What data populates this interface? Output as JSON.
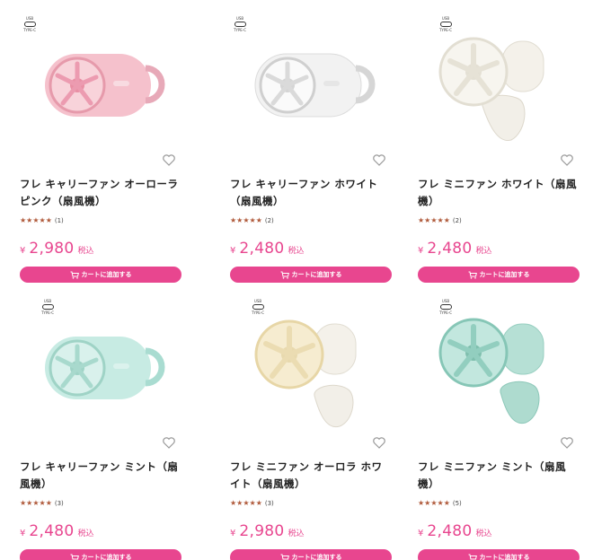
{
  "usb_label_top": "USB",
  "usb_label_bottom": "TYPE-C",
  "products": [
    {
      "title": "フレ キャリーファン オーローラピンク（扇風機）",
      "stars": "★★★★★",
      "reviews": "(1)",
      "currency": "¥",
      "price": "2,980",
      "tax": "税込",
      "cart_label": "カートに追加する",
      "color": "#f2b7c4",
      "type": "carry"
    },
    {
      "title": "フレ キャリーファン ホワイト（扇風機）",
      "stars": "★★★★★",
      "reviews": "(2)",
      "currency": "¥",
      "price": "2,480",
      "tax": "税込",
      "cart_label": "カートに追加する",
      "color": "#eeeeee",
      "type": "carry"
    },
    {
      "title": "フレ ミニファン ホワイト（扇風機）",
      "stars": "★★★★★",
      "reviews": "(2)",
      "currency": "¥",
      "price": "2,480",
      "tax": "税込",
      "cart_label": "カートに追加する",
      "color": "#f3f0e6",
      "type": "mini"
    },
    {
      "title": "フレ キャリーファン ミント（扇風機）",
      "stars": "★★★★★",
      "reviews": "(3)",
      "currency": "¥",
      "price": "2,480",
      "tax": "税込",
      "cart_label": "カートに追加する",
      "color": "#bfe6de",
      "type": "carry"
    },
    {
      "title": "フレ ミニファン オーロラ ホワイト（扇風機）",
      "stars": "★★★★★",
      "reviews": "(3)",
      "currency": "¥",
      "price": "2,980",
      "tax": "税込",
      "cart_label": "カートに追加する",
      "color": "#f2e6c2",
      "type": "mini"
    },
    {
      "title": "フレ ミニファン ミント（扇風機）",
      "stars": "★★★★★",
      "reviews": "(5)",
      "currency": "¥",
      "price": "2,480",
      "tax": "税込",
      "cart_label": "カートに追加する",
      "color": "#9fd6c8",
      "type": "mini"
    }
  ]
}
